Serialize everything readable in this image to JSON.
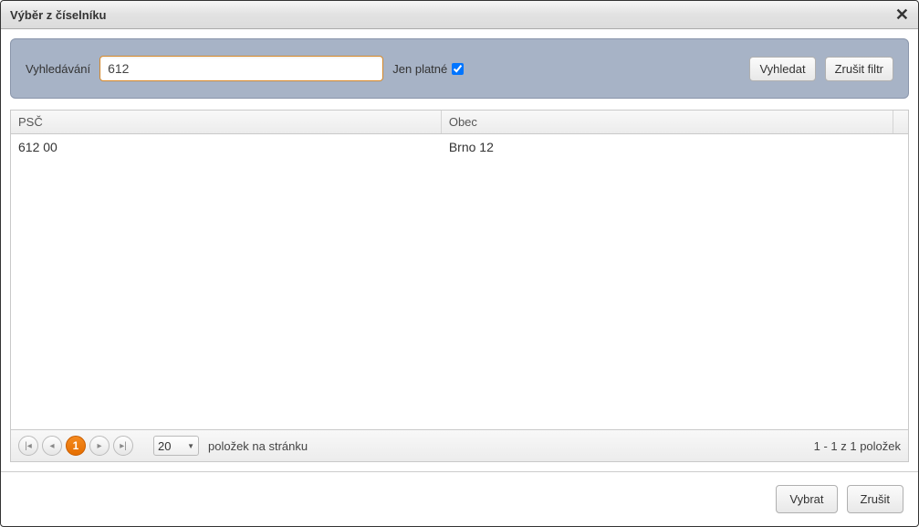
{
  "dialog": {
    "title": "Výběr z číselníku"
  },
  "search": {
    "label": "Vyhledávání",
    "value": "612",
    "valid_label": "Jen platné",
    "valid_checked": true,
    "search_btn": "Vyhledat",
    "clear_btn": "Zrušit filtr"
  },
  "grid": {
    "columns": {
      "psc": "PSČ",
      "obec": "Obec"
    },
    "rows": [
      {
        "psc": "612 00",
        "obec": "Brno 12"
      }
    ]
  },
  "pager": {
    "current_page": "1",
    "page_size": "20",
    "items_per_page_label": "položek na stránku",
    "summary": "1 - 1 z 1 položek"
  },
  "footer": {
    "select_btn": "Vybrat",
    "cancel_btn": "Zrušit"
  }
}
